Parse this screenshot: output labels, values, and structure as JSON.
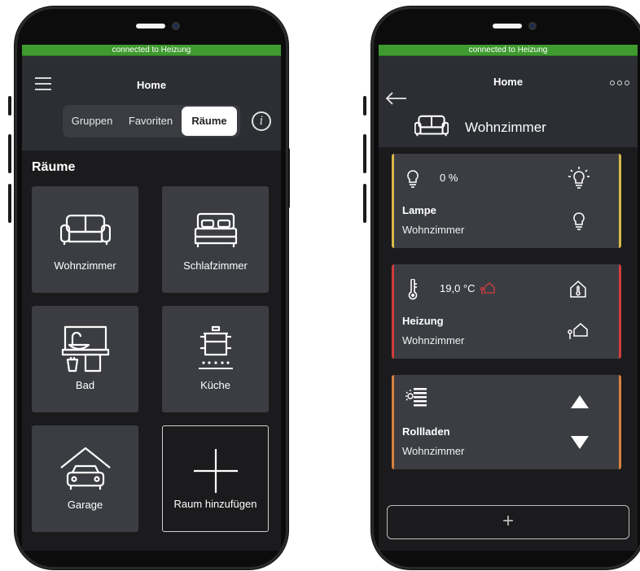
{
  "connection_status": "connected to Heizung",
  "left": {
    "header_title": "Home",
    "tabs": [
      {
        "label": "Gruppen",
        "active": false
      },
      {
        "label": "Favoriten",
        "active": false
      },
      {
        "label": "Räume",
        "active": true
      }
    ],
    "info_glyph": "i",
    "section_title": "Räume",
    "rooms": [
      {
        "label": "Wohnzimmer",
        "icon": "sofa-icon"
      },
      {
        "label": "Schlafzimmer",
        "icon": "bed-icon"
      },
      {
        "label": "Bad",
        "icon": "bathroom-sink-icon"
      },
      {
        "label": "Küche",
        "icon": "cooking-pot-icon"
      },
      {
        "label": "Garage",
        "icon": "garage-car-icon"
      }
    ],
    "add_room_label": "Raum hinzufügen"
  },
  "right": {
    "header_title": "Home",
    "room_title": "Wohnzimmer",
    "devices": [
      {
        "name": "Lampe",
        "room": "Wohnzimmer",
        "value": "0 %",
        "accent": "#d9b84a",
        "icon": "bulb-icon"
      },
      {
        "name": "Heizung",
        "room": "Wohnzimmer",
        "value": "19,0 °C",
        "accent": "#d23c3c",
        "icon": "thermometer-icon"
      },
      {
        "name": "Rollladen",
        "room": "Wohnzimmer",
        "value": "",
        "accent": "#d9813f",
        "icon": "blinds-icon"
      }
    ],
    "add_button_label": "+"
  },
  "colors": {
    "connected": "#3f9a2f",
    "tile": "#3b3d43",
    "header": "#2c2e33",
    "screen_bg": "#1b1b1d"
  }
}
